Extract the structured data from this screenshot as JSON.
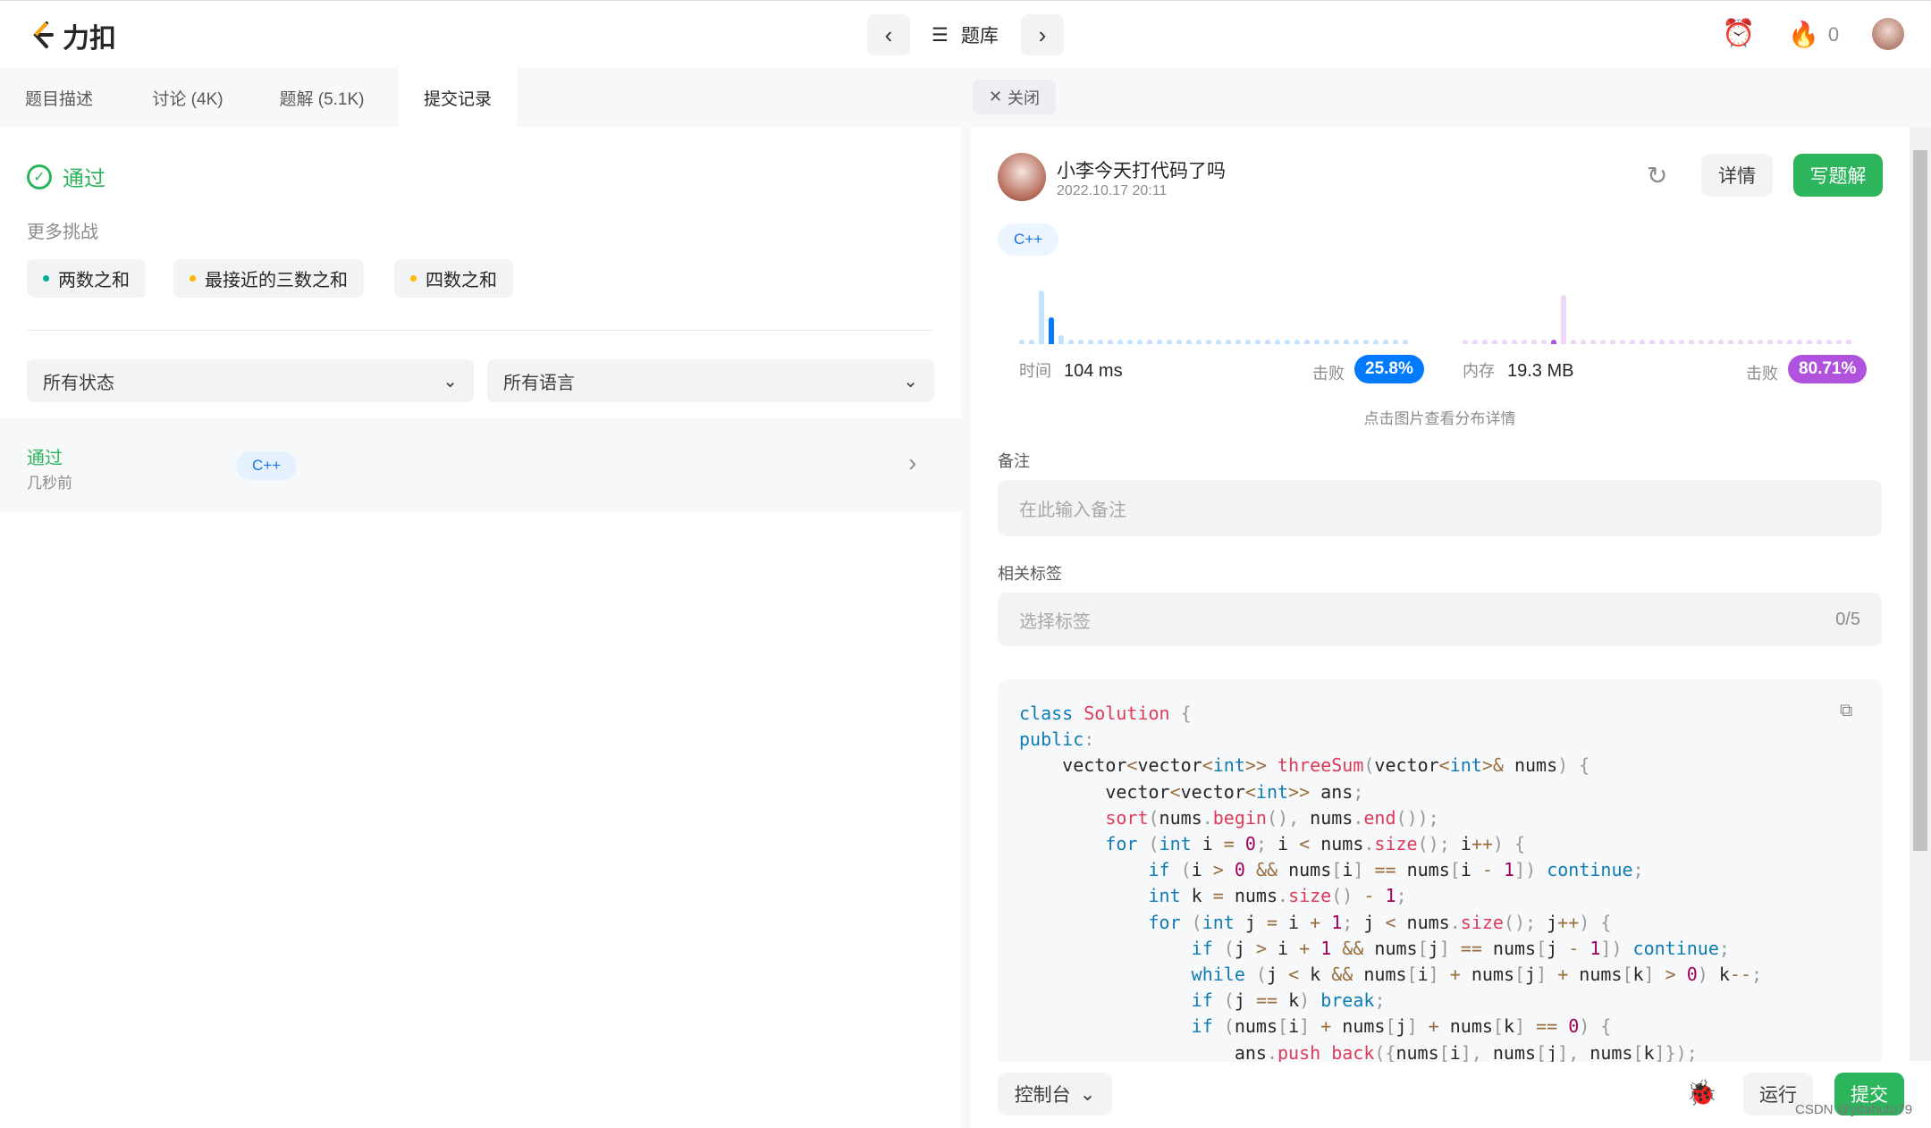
{
  "header": {
    "logo_text": "力扣",
    "problem_list": "题库",
    "fire_count": "0"
  },
  "tabs": [
    {
      "label": "题目描述"
    },
    {
      "label": "讨论 (4K)"
    },
    {
      "label": "题解 (5.1K)"
    },
    {
      "label": "提交记录",
      "active": true
    }
  ],
  "close_tab": "关闭",
  "left": {
    "status": "通过",
    "more_challenges": "更多挑战",
    "challenges": [
      {
        "label": "两数之和",
        "color": "#00af9b"
      },
      {
        "label": "最接近的三数之和",
        "color": "#ffb800"
      },
      {
        "label": "四数之和",
        "color": "#ffb800"
      }
    ],
    "filter_status": "所有状态",
    "filter_language": "所有语言",
    "submission": {
      "status": "通过",
      "time": "几秒前",
      "language": "C++"
    }
  },
  "right": {
    "username": "小李今天打代码了吗",
    "timestamp": "2022.10.17 20:11",
    "detail_button": "详情",
    "write_solution_button": "写题解",
    "language": "C++",
    "runtime": {
      "label": "时间",
      "value": "104 ms",
      "beats_label": "击败",
      "beats": "25.8%",
      "color": "#007aff"
    },
    "memory": {
      "label": "内存",
      "value": "19.3 MB",
      "beats_label": "击败",
      "beats": "80.71%",
      "color": "#af52de"
    },
    "chart_hint": "点击图片查看分布详情",
    "note_label": "备注",
    "note_placeholder": "在此输入备注",
    "tags_label": "相关标签",
    "tags_placeholder": "选择标签",
    "tags_count": "0/5",
    "code": [
      "class Solution {",
      "public:",
      "    vector<vector<int>> threeSum(vector<int>& nums) {",
      "        vector<vector<int>> ans;",
      "        sort(nums.begin(), nums.end());",
      "        for (int i = 0; i < nums.size(); i++) {",
      "            if (i > 0 && nums[i] == nums[i - 1]) continue;",
      "            int k = nums.size() - 1;",
      "            for (int j = i + 1; j < nums.size(); j++) {",
      "                if (j > i + 1 && nums[j] == nums[j - 1]) continue;",
      "                while (j < k && nums[i] + nums[j] + nums[k] > 0) k--;",
      "                if (j == k) break;",
      "                if (nums[i] + nums[j] + nums[k] == 0) {",
      "                    ans.push_back({nums[i], nums[j], nums[k]});"
    ]
  },
  "footer": {
    "console": "控制台",
    "run": "运行",
    "submit": "提交",
    "watermark": "CSDN @yitahutu79"
  }
}
